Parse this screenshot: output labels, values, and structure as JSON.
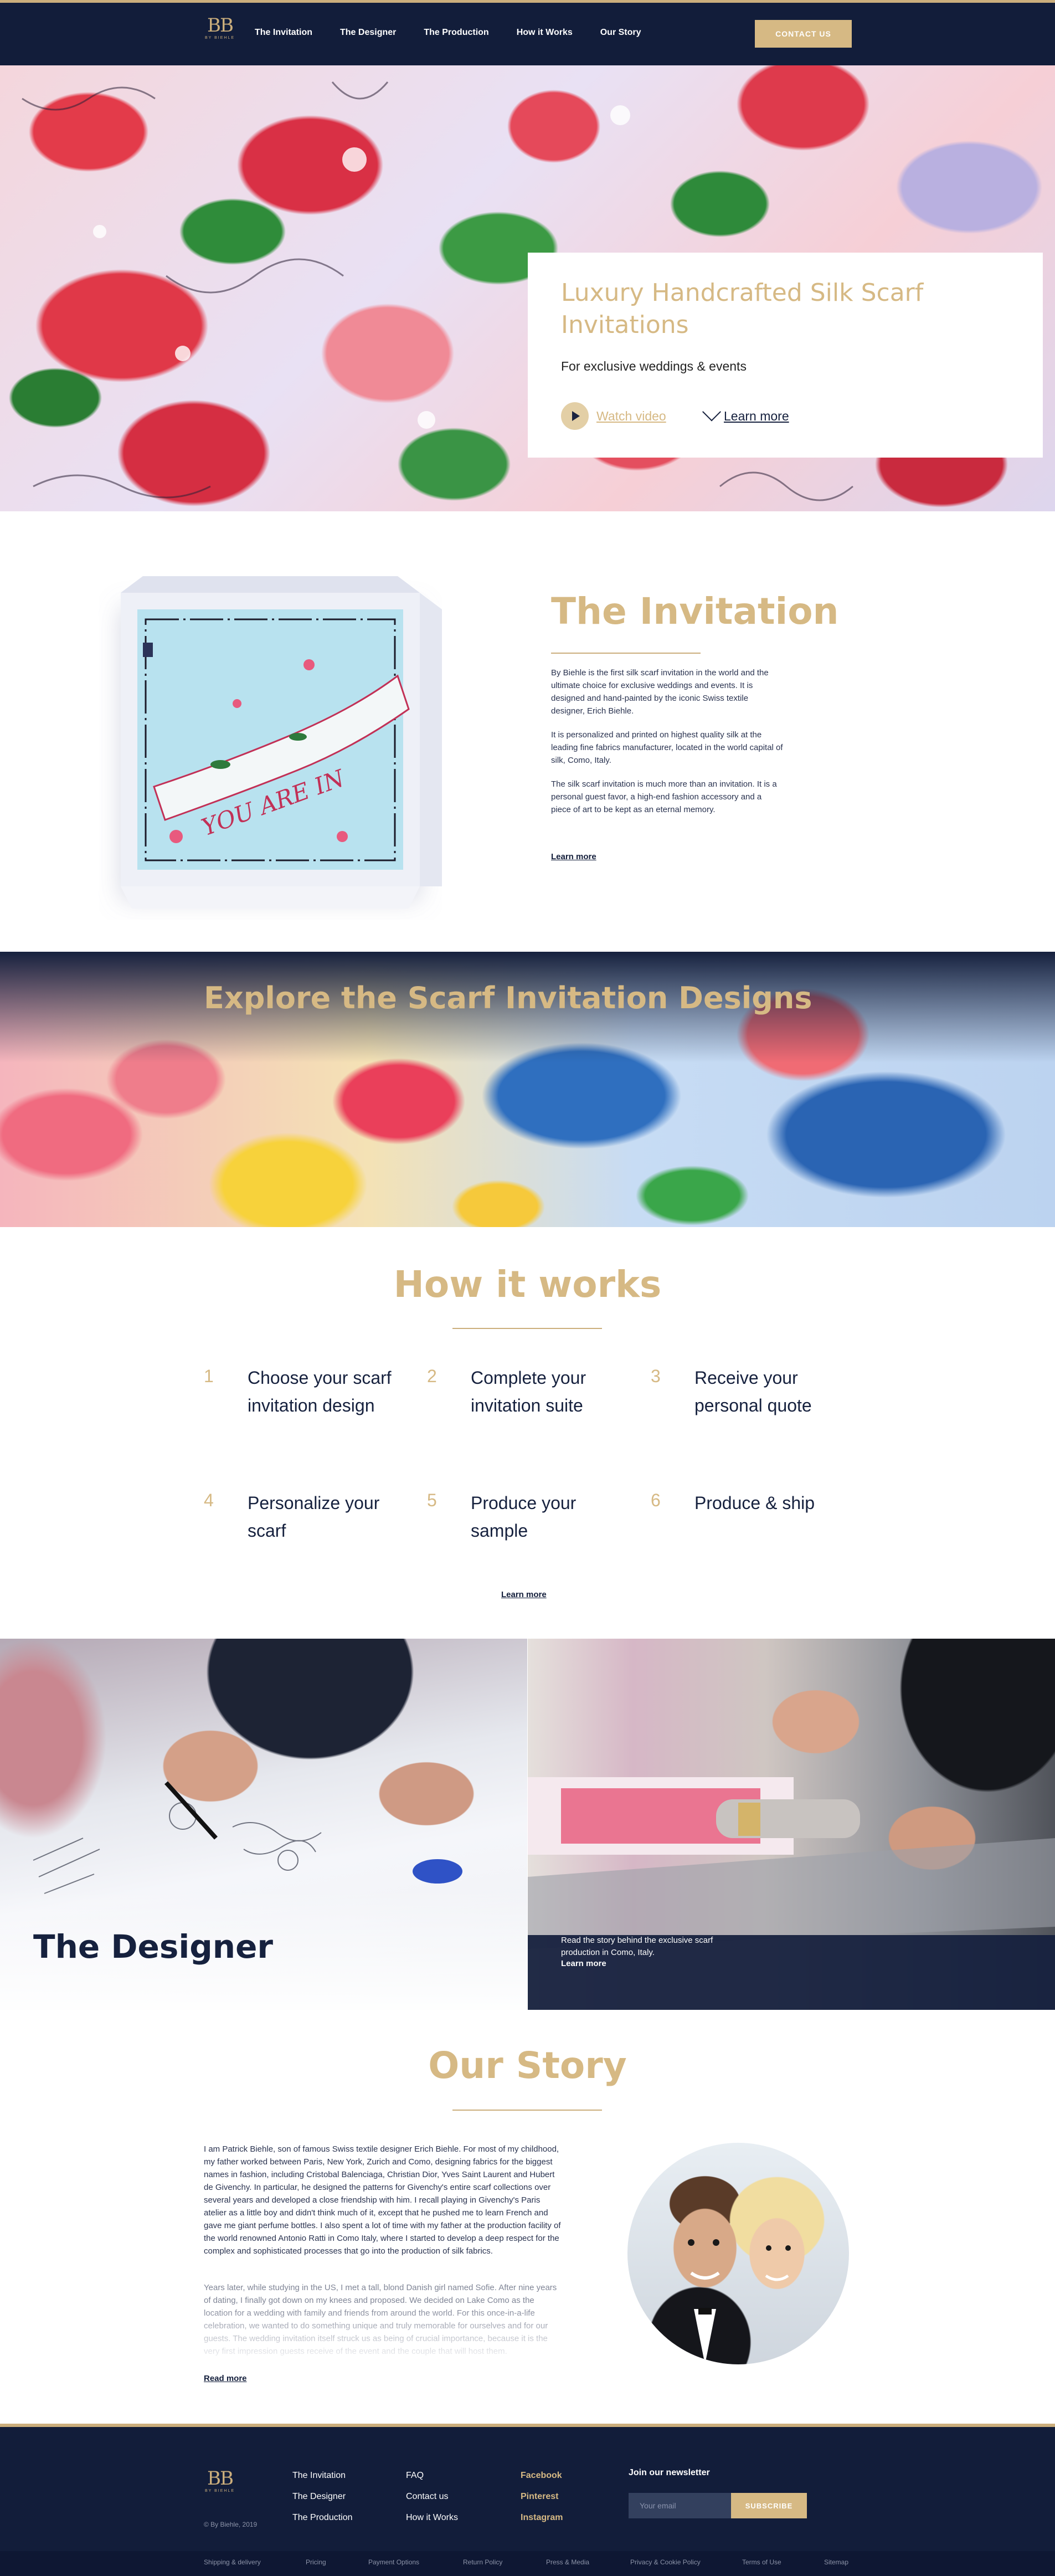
{
  "header": {
    "logo_text": "BB",
    "logo_sub": "BY BIEHLE",
    "nav": [
      "The Invitation",
      "The Designer",
      "The Production",
      "How it Works",
      "Our Story"
    ],
    "contact_label": "CONTACT US"
  },
  "hero": {
    "title": "Luxury Handcrafted Silk Scarf Invitations",
    "subtitle": "For exclusive weddings & events",
    "watch_label": "Watch video",
    "learn_label": "Learn more"
  },
  "invitation": {
    "title": "The Invitation",
    "p1": "By Biehle is the first silk scarf invitation in the world and the ultimate choice for exclusive weddings and events. It is designed and hand-painted by the iconic Swiss textile designer, Erich Biehle.",
    "p2": "It is personalized and printed on highest quality silk at the leading fine fabrics manufacturer, located in the world capital of silk, Como, Italy.",
    "p3": "The silk scarf invitation is much more than an invitation. It is a personal guest favor, a high-end fashion accessory and a piece of art to be kept as an eternal memory.",
    "learn_label": "Learn more",
    "scarf_text": "YOU ARE IN"
  },
  "explore": {
    "title": "Explore the Scarf Invitation Designs"
  },
  "how": {
    "title": "How it works",
    "steps": [
      {
        "num": "1",
        "text": "Choose your scarf invitation design"
      },
      {
        "num": "2",
        "text": "Complete your invitation suite"
      },
      {
        "num": "3",
        "text": "Receive your personal quote"
      },
      {
        "num": "4",
        "text": "Personalize your scarf"
      },
      {
        "num": "5",
        "text": "Produce your sample"
      },
      {
        "num": "6",
        "text": "Produce & ship"
      }
    ],
    "learn_label": "Learn more"
  },
  "designer": {
    "title": "The Designer"
  },
  "production": {
    "text": "Read the story behind the exclusive scarf production in Como, Italy.",
    "learn_label": "Learn more"
  },
  "story": {
    "title": "Our Story",
    "p1": "I am Patrick Biehle, son of famous Swiss textile designer Erich Biehle. For most of my childhood, my father worked between Paris, New York, Zurich and Como, designing fabrics for the biggest names in fashion, including Cristobal Balenciaga, Christian Dior, Yves Saint Laurent and Hubert de Givenchy. In particular, he designed the patterns for Givenchy's entire scarf collections over several years and developed a close friendship with him. I recall playing in Givenchy's Paris atelier as a little boy and didn't think much of it, except that he pushed me to learn French and gave me giant perfume bottles. I also spent a lot of time with my father at the production facility of the world renowned Antonio Ratti in Como Italy, where I started to develop a deep respect for the complex and sophisticated processes that go into the production of silk fabrics.",
    "p2": "Years later, while studying in the US, I met a tall, blond Danish girl named Sofie. After nine years of dating, I finally got down on my knees and proposed. We decided on Lake Como as the location for a wedding with family and friends from around the world. For this once-in-a-life celebration, we wanted to do something unique and truly memorable for ourselves and for our guests. The wedding invitation itself struck us as being of crucial importance, because it is the very first impression guests receive of the event and the couple that will host them.",
    "read_label": "Read more"
  },
  "footer": {
    "copyright": "© By Biehle, 2019",
    "col1": [
      "The Invitation",
      "The Designer",
      "The Production"
    ],
    "col2": [
      "FAQ",
      "Contact us",
      "How it Works"
    ],
    "col3": [
      "Facebook",
      "Pinterest",
      "Instagram"
    ],
    "newsletter_title": "Join our newsletter",
    "email_placeholder": "Your email",
    "subscribe_label": "SUBSCRIBE",
    "bottom_links": [
      "Shipping & delivery",
      "Pricing",
      "Payment Options",
      "Return Policy",
      "Press & Media",
      "Privacy & Cookie Policy",
      "Terms of Use",
      "Sitemap"
    ]
  },
  "colors": {
    "navy": "#121d3a",
    "gold": "#d6b984"
  }
}
